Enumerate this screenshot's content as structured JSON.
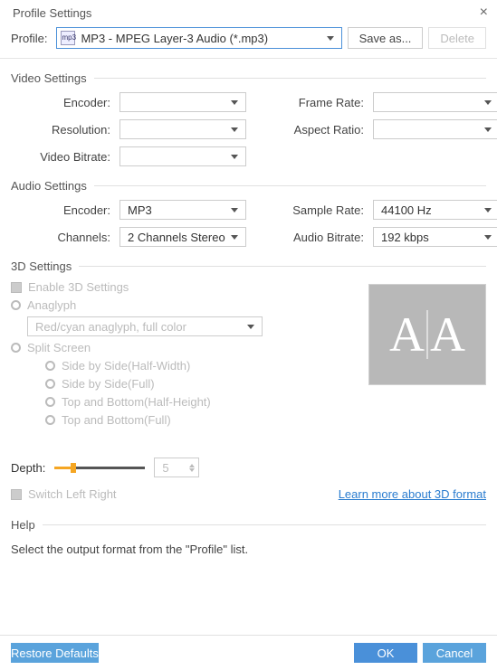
{
  "window": {
    "title": "Profile Settings"
  },
  "profile": {
    "label": "Profile:",
    "selected": "MP3 - MPEG Layer-3 Audio (*.mp3)",
    "icon_label": "mp3",
    "save_as": "Save as...",
    "delete": "Delete"
  },
  "video": {
    "section": "Video Settings",
    "encoder_label": "Encoder:",
    "resolution_label": "Resolution:",
    "video_bitrate_label": "Video Bitrate:",
    "frame_rate_label": "Frame Rate:",
    "aspect_ratio_label": "Aspect Ratio:",
    "encoder": "",
    "resolution": "",
    "video_bitrate": "",
    "frame_rate": "",
    "aspect_ratio": ""
  },
  "audio": {
    "section": "Audio Settings",
    "encoder_label": "Encoder:",
    "channels_label": "Channels:",
    "sample_rate_label": "Sample Rate:",
    "audio_bitrate_label": "Audio Bitrate:",
    "encoder": "MP3",
    "channels": "2 Channels Stereo",
    "sample_rate": "44100 Hz",
    "audio_bitrate": "192 kbps"
  },
  "threeD": {
    "section": "3D Settings",
    "enable": "Enable 3D Settings",
    "anaglyph": "Anaglyph",
    "anaglyph_mode": "Red/cyan anaglyph, full color",
    "split_screen": "Split Screen",
    "sbs_half": "Side by Side(Half-Width)",
    "sbs_full": "Side by Side(Full)",
    "tab_half": "Top and Bottom(Half-Height)",
    "tab_full": "Top and Bottom(Full)",
    "depth_label": "Depth:",
    "depth_value": "5",
    "switch_lr": "Switch Left Right",
    "learn_more": "Learn more about 3D format"
  },
  "help": {
    "section": "Help",
    "text": "Select the output format from the \"Profile\" list."
  },
  "footer": {
    "restore": "Restore Defaults",
    "ok": "OK",
    "cancel": "Cancel"
  }
}
